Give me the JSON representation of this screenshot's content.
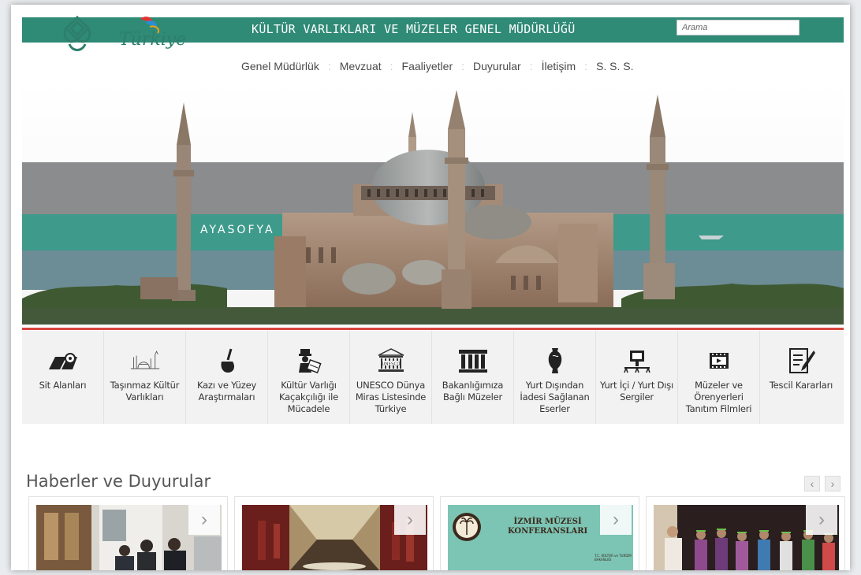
{
  "header": {
    "site_title": "KÜLTÜR VARLIKLARI VE MÜZELER GENEL MÜDÜRLÜĞÜ",
    "search_placeholder": "Arama",
    "logo_text": "Türkiye"
  },
  "nav": {
    "items": [
      {
        "label": "Genel Müdürlük"
      },
      {
        "label": "Mevzuat"
      },
      {
        "label": "Faaliyetler"
      },
      {
        "label": "Duyurular"
      },
      {
        "label": "İletişim"
      },
      {
        "label": "S. S. S."
      }
    ]
  },
  "hero": {
    "caption": "AYASOFYA"
  },
  "tiles": [
    {
      "label": "Sit Alanları",
      "icon": "map-icon"
    },
    {
      "label": "Taşınmaz Kültür Varlıkları",
      "icon": "building-sketch-icon"
    },
    {
      "label": "Kazı ve Yüzey Araştırmaları",
      "icon": "trowel-icon"
    },
    {
      "label": "Kültür Varlığı Kaçakçılığı ile Mücadele",
      "icon": "smuggler-icon"
    },
    {
      "label": "UNESCO Dünya Miras Listesinde Türkiye",
      "icon": "unesco-icon"
    },
    {
      "label": "Bakanlığımıza Bağlı Müzeler",
      "icon": "museum-icon"
    },
    {
      "label": "Yurt Dışından İadesi Sağlanan Eserler",
      "icon": "amphora-icon"
    },
    {
      "label": "Yurt İçi / Yurt Dışı Sergiler",
      "icon": "exhibition-icon"
    },
    {
      "label": "Müzeler ve Örenyerleri Tanıtım Filmleri",
      "icon": "film-icon"
    },
    {
      "label": "Tescil Kararları",
      "icon": "document-edit-icon"
    }
  ],
  "news": {
    "heading": "Haberler ve Duyurular",
    "prev_label": "‹",
    "next_label": "›",
    "card_next_label": "›",
    "cards": [
      {
        "caption": ""
      },
      {
        "caption": ""
      },
      {
        "caption": "İZMİR MÜZESİ KONFERANSLARI",
        "line1": "İZMİR MÜZESİ",
        "line2": "KONFERANSLARI",
        "sub": "T.C. KÜLTÜR ve TURİZM BAKANLIĞI"
      },
      {
        "caption": ""
      }
    ]
  },
  "colors": {
    "header_green": "#2f8a76",
    "accent_red": "#d8443c",
    "tile_bg": "#f2f2f2"
  }
}
